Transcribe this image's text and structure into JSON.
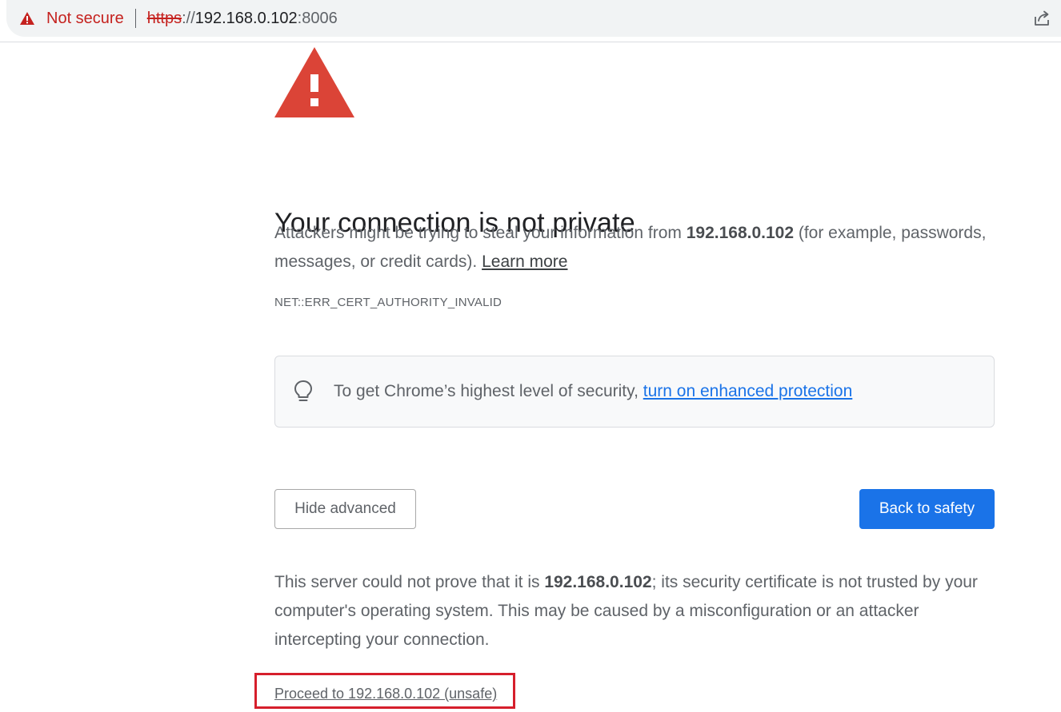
{
  "address_bar": {
    "security_label": "Not secure",
    "url_scheme": "https",
    "url_separator": "://",
    "url_host": "192.168.0.102",
    "url_port": ":8006",
    "security_color": "#c5221f"
  },
  "interstitial": {
    "heading": "Your connection is not private",
    "para1_before": "Attackers might be trying to steal your information from ",
    "para1_host": "192.168.0.102",
    "para1_after": " (for example, passwords, messages, or credit cards). ",
    "learn_more": "Learn more",
    "error_code": "NET::ERR_CERT_AUTHORITY_INVALID",
    "enhanced_text": "To get Chrome’s highest level of security, ",
    "enhanced_link": "turn on enhanced protection",
    "hide_advanced": "Hide advanced",
    "back_to_safety": "Back to safety",
    "para2_before": "This server could not prove that it is ",
    "para2_host": "192.168.0.102",
    "para2_after": "; its security certificate is not trusted by your computer's operating system. This may be caused by a misconfiguration or an attacker intercepting your connection.",
    "proceed_link": "Proceed to 192.168.0.102 (unsafe)",
    "warning_color": "#db4437",
    "primary_button_color": "#1a73e8",
    "highlight_box_color": "#d61f2c"
  },
  "icons": {
    "security": "warning-triangle-icon",
    "share": "share-icon",
    "hero": "warning-triangle-icon",
    "enhanced": "lightbulb-icon"
  }
}
